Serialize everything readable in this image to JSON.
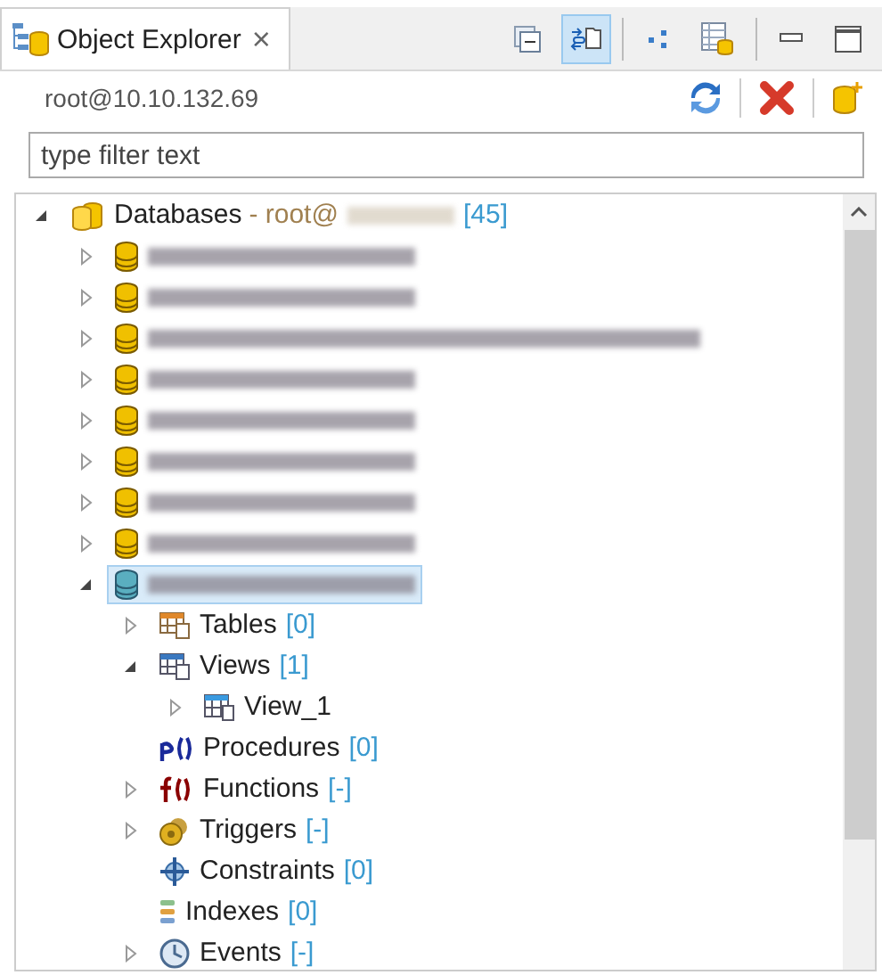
{
  "tab": {
    "title": "Object Explorer",
    "close": "×",
    "selected": true
  },
  "view_toolbar": [
    {
      "kind": "collapse",
      "on": false
    },
    {
      "kind": "link",
      "on": true
    },
    {
      "kind": "dots",
      "on": false
    },
    {
      "kind": "tabledb",
      "on": false
    },
    {
      "kind": "minimize",
      "on": false
    },
    {
      "kind": "maximize",
      "on": false
    }
  ],
  "connection": {
    "label": "root@10.10.132.69"
  },
  "connection_toolbar": [
    {
      "kind": "refresh"
    },
    {
      "kind": "disconnect"
    },
    {
      "kind": "newdb"
    }
  ],
  "filter": {
    "placeholder": "type filter text"
  },
  "tree": [
    {
      "kind": "databases",
      "label": "Databases",
      "host": "- root@",
      "host_redacted": true,
      "count": "[45]",
      "expanded": true,
      "selected": false,
      "children": [
        {
          "kind": "database",
          "redacted": true,
          "expanded": false,
          "selected": false
        },
        {
          "kind": "database",
          "redacted": true,
          "expanded": false,
          "selected": false
        },
        {
          "kind": "database",
          "redacted": true,
          "long": true,
          "expanded": false,
          "selected": false
        },
        {
          "kind": "database",
          "redacted": true,
          "expanded": false,
          "selected": false
        },
        {
          "kind": "database",
          "redacted": true,
          "expanded": false,
          "selected": false
        },
        {
          "kind": "database",
          "redacted": true,
          "expanded": false,
          "selected": false
        },
        {
          "kind": "database",
          "redacted": true,
          "expanded": false,
          "selected": false
        },
        {
          "kind": "database",
          "redacted": true,
          "expanded": false,
          "selected": false
        },
        {
          "kind": "database",
          "redacted": true,
          "expanded": true,
          "selected": true,
          "children": [
            {
              "kind": "tables",
              "label": "Tables",
              "count": "[0]",
              "expanded": false,
              "selected": false
            },
            {
              "kind": "views",
              "label": "Views",
              "count": "[1]",
              "expanded": true,
              "selected": false,
              "children": [
                {
                  "kind": "view",
                  "label": "View_1",
                  "expanded": false,
                  "selected": false
                }
              ]
            },
            {
              "kind": "procedures",
              "label": "Procedures",
              "count": "[0]",
              "selected": false
            },
            {
              "kind": "functions",
              "label": "Functions",
              "count": "[-]",
              "expanded": false,
              "selected": false
            },
            {
              "kind": "triggers",
              "label": "Triggers",
              "count": "[-]",
              "expanded": false,
              "selected": false
            },
            {
              "kind": "constraints",
              "label": "Constraints",
              "count": "[0]",
              "selected": false
            },
            {
              "kind": "indexes",
              "label": "Indexes",
              "count": "[0]",
              "selected": false
            },
            {
              "kind": "events",
              "label": "Events",
              "count": "[-]",
              "expanded": false,
              "selected": false
            }
          ]
        }
      ]
    }
  ]
}
